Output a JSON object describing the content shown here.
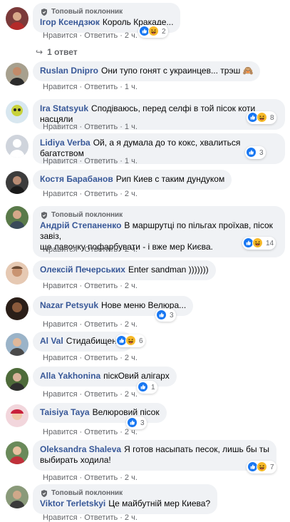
{
  "badge_label": "Топовый поклонник",
  "actions": {
    "like": "Нравится",
    "reply": "Ответить"
  },
  "reply_thread": {
    "label": "1 ответ"
  },
  "comments": [
    {
      "author": "Ігор Ксендзюк",
      "text": "Король Кракаде...",
      "time": "2 ч.",
      "reactions_count": "2"
    },
    {
      "author": "Ruslan Dnipro",
      "text": "Они тупо гонят с украинцев... трэш 🙈",
      "time": "1 ч.",
      "reactions_count": ""
    },
    {
      "author": "Ira Statsyuk",
      "text": "Сподіваюсь, перед селфі в той пісок коти насцяли",
      "time": "1 ч.",
      "reactions_count": "8"
    },
    {
      "author": "Lidiya Verba",
      "text": "Ой, а я думала до то кокс, хвалиться багатством",
      "time": "1 ч.",
      "reactions_count": "3"
    },
    {
      "author": "Костя Барабанов",
      "text": "Рип Киев с таким дундуком",
      "time": "2 ч.",
      "reactions_count": ""
    },
    {
      "author": "Андрій Степаненко",
      "text_line1": "В маршрутці по пільгах проїхав, пісок завіз,",
      "text_line2": "ще лавочку пофарбувати - і вже мер Києва.",
      "time": "2 ч.",
      "reactions_count": "14"
    },
    {
      "author": "Олексій Печерських",
      "text": "Enter sandman )))))))",
      "time": "2 ч.",
      "reactions_count": ""
    },
    {
      "author": "Nazar Petsyuk",
      "text": "Нове меню Велюра...",
      "time": "2 ч.",
      "reactions_count": "3"
    },
    {
      "author": "Al Val",
      "text": "Стидабищенко",
      "time": "2 ч.",
      "reactions_count": "6"
    },
    {
      "author": "Alla Yakhonina",
      "text": "піскОвий алігарх",
      "time": "2 ч.",
      "reactions_count": "1"
    },
    {
      "author": "Taisiya Taya",
      "text": "Велюровий пісок",
      "time": "2 ч.",
      "reactions_count": "3"
    },
    {
      "author": "Oleksandra Shaleva",
      "text_line1": "Я готов насыпать песок, лишь бы ты",
      "text_line2": "выбирать ходила!",
      "time": "2 ч.",
      "reactions_count": "7"
    },
    {
      "author": "Viktor Terletskyi",
      "text": "Це майбутній мер Киева?",
      "time": "2 ч.",
      "reactions_count": ""
    }
  ],
  "colors": {
    "author": "#385898",
    "bubble": "#f0f2f5",
    "meta": "#65676b",
    "like_blue": "#1877f2",
    "haha_yellow": "#f7b928"
  }
}
